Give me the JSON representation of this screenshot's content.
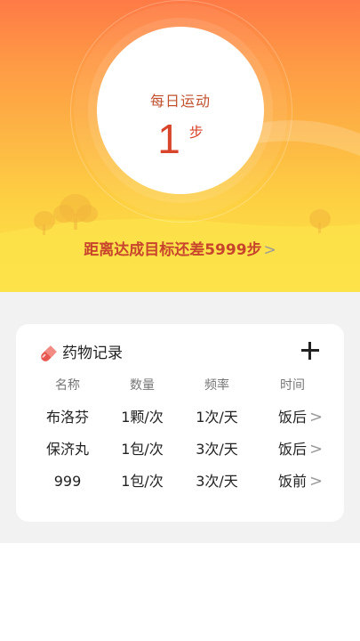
{
  "hero": {
    "title": "每日运动",
    "steps": "1",
    "steps_unit": "步",
    "goal_text": "距离达成目标还差5999步",
    "goal_chevron": ">"
  },
  "medicine": {
    "title": "药物记录",
    "add_label": "+",
    "columns": [
      "名称",
      "数量",
      "频率",
      "时间"
    ],
    "rows": [
      {
        "name": "布洛芬",
        "qty": "1颗/次",
        "freq": "1次/天",
        "time": "饭后"
      },
      {
        "name": "保济丸",
        "qty": "1包/次",
        "freq": "3次/天",
        "time": "饭后"
      },
      {
        "name": "999",
        "qty": "1包/次",
        "freq": "3次/天",
        "time": "饭前"
      }
    ],
    "row_chevron": ">"
  },
  "colors": {
    "accent": "#d8452b",
    "hero_top": "#fe7a46",
    "hero_bottom": "#fde64b",
    "pill_icon": "#e8574f"
  }
}
